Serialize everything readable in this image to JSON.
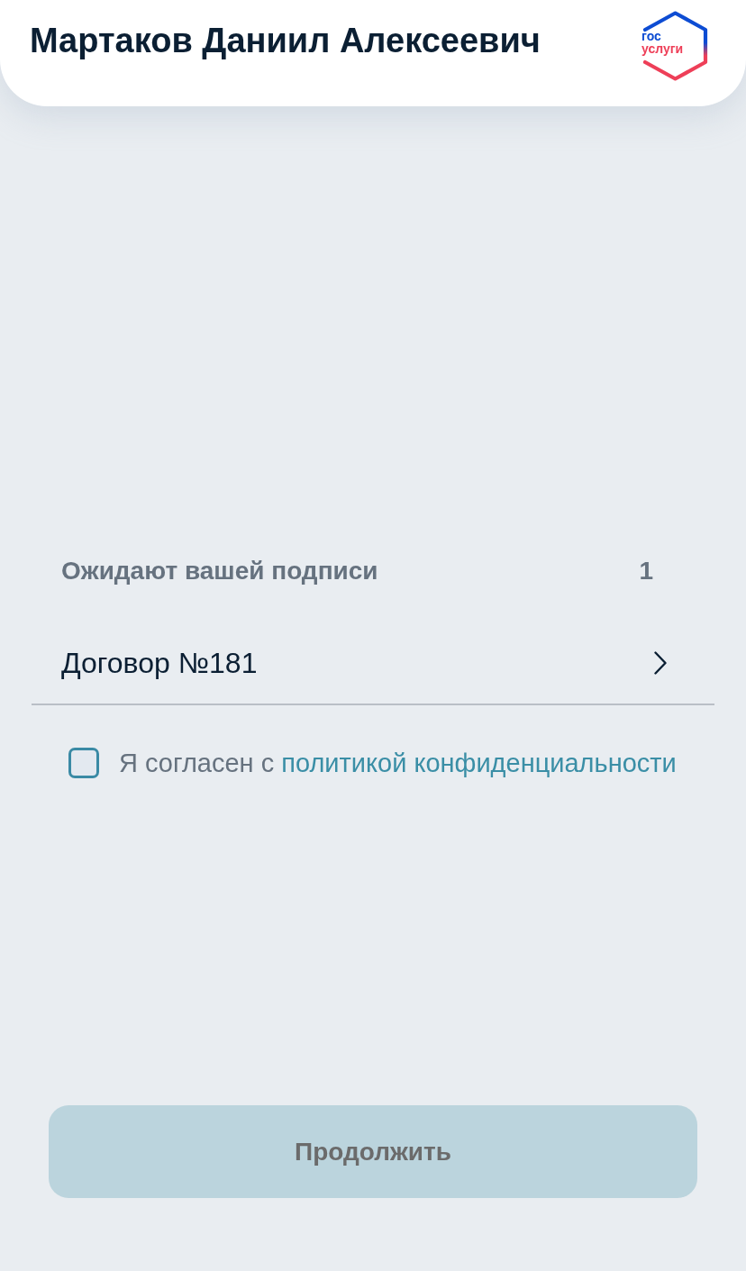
{
  "header": {
    "title": "Мартаков Даниил Алексеевич",
    "logo": {
      "line_1": "гос",
      "line_2": "услуги"
    }
  },
  "pending": {
    "label": "Ожидают вашей подписи",
    "count": "1",
    "documents": [
      {
        "title": "Договор №181"
      }
    ]
  },
  "consent": {
    "checked": false,
    "text": "Я согласен с",
    "link": "политикой конфиденциальности"
  },
  "continue_button": {
    "label": "Продолжить",
    "disabled": true
  }
}
